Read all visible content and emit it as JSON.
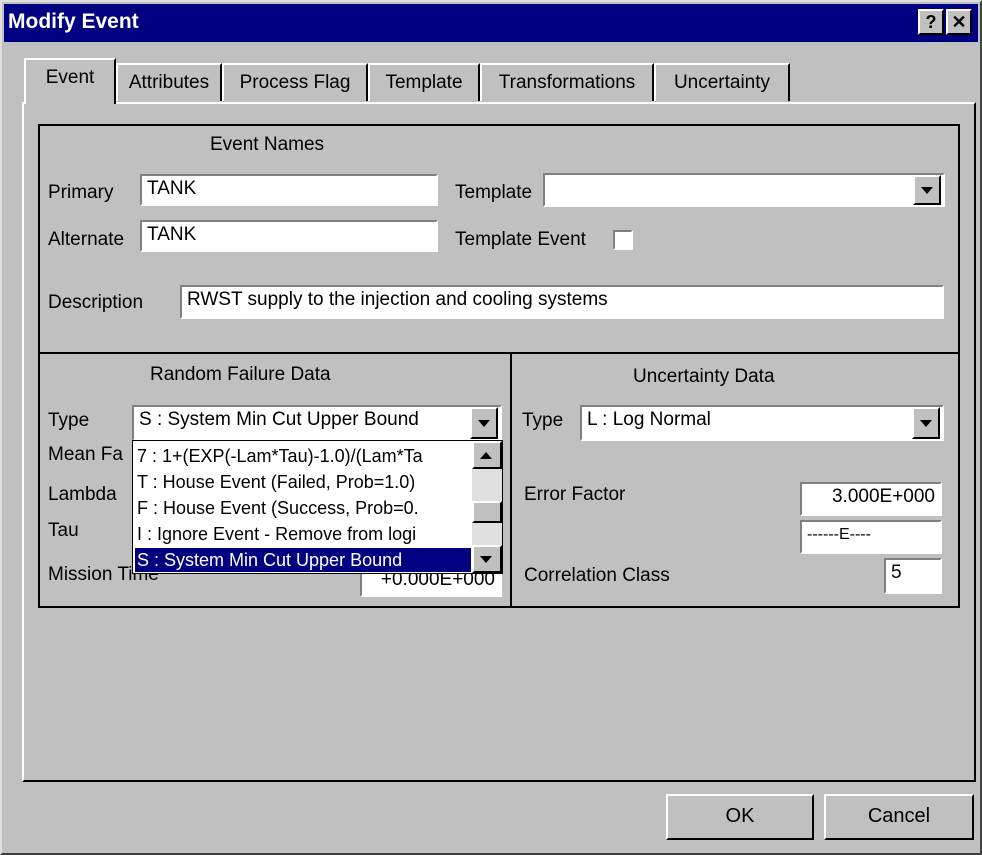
{
  "window": {
    "title": "Modify Event",
    "help_glyph": "?",
    "close_glyph": "✕"
  },
  "tabs": [
    {
      "label": "Event",
      "active": true
    },
    {
      "label": "Attributes"
    },
    {
      "label": "Process Flag"
    },
    {
      "label": "Template"
    },
    {
      "label": "Transformations"
    },
    {
      "label": "Uncertainty"
    }
  ],
  "event_names": {
    "heading": "Event Names",
    "primary_label": "Primary",
    "primary_value": "TANK",
    "alternate_label": "Alternate",
    "alternate_value": "TANK",
    "template_label": "Template",
    "template_value": "",
    "template_event_label": "Template Event",
    "template_event_checked": false,
    "description_label": "Description",
    "description_value": "RWST supply to the injection and cooling systems"
  },
  "random_failure": {
    "heading": "Random Failure Data",
    "type_label": "Type",
    "type_value": "S : System Min Cut Upper Bound",
    "mean_label": "Mean Fa",
    "lambda_label": "Lambda",
    "tau_label": "Tau",
    "mission_label": "Mission Time",
    "mission_value": "+0.000E+000",
    "dropdown_options": [
      "7 : 1+(EXP(-Lam*Tau)-1.0)/(Lam*Ta",
      "T : House Event (Failed, Prob=1.0)",
      "F : House Event (Success, Prob=0.",
      "I : Ignore Event - Remove from logi",
      "S : System Min Cut Upper Bound"
    ],
    "selected_option": "S : System Min Cut Upper Bound"
  },
  "uncertainty": {
    "heading": "Uncertainty Data",
    "type_label": "Type",
    "type_value": "L : Log Normal",
    "error_factor_label": "Error Factor",
    "error_factor_value": "3.000E+000",
    "second_value": "------E----",
    "correlation_label": "Correlation Class",
    "correlation_value": "5"
  },
  "buttons": {
    "ok": "OK",
    "cancel": "Cancel"
  }
}
